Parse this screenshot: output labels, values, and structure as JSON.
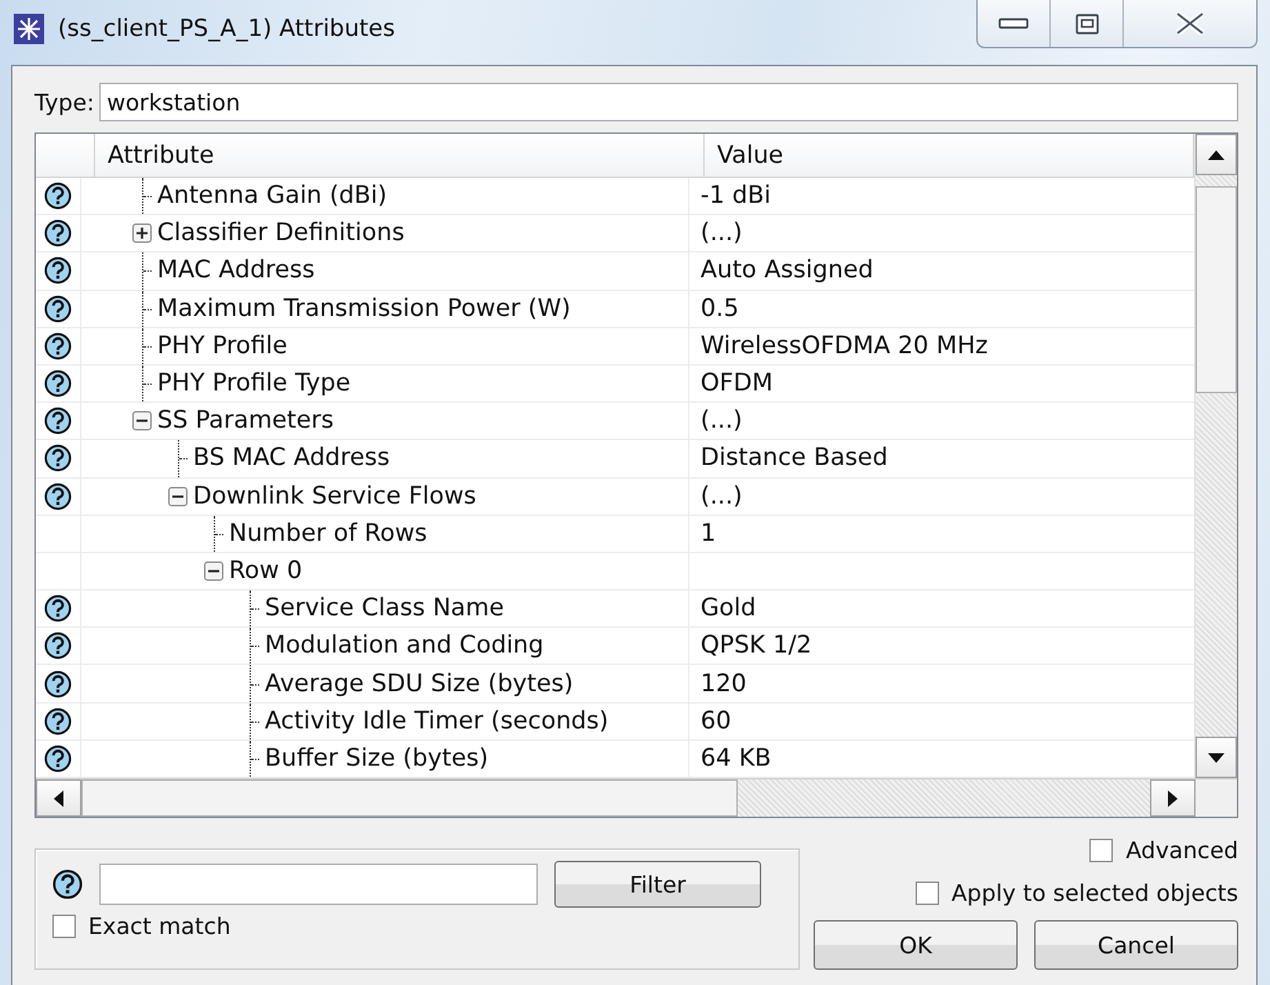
{
  "window": {
    "title": "(ss_client_PS_A_1) Attributes"
  },
  "type_field": {
    "label": "Type:",
    "value": "workstation"
  },
  "table": {
    "columns": [
      "Attribute",
      "Value"
    ],
    "rows": [
      {
        "label": "Antenna Gain (dBi)",
        "value": "-1 dBi",
        "help": true
      },
      {
        "label": "Classifier Definitions",
        "value": "(...)",
        "help": true,
        "expanded": false
      },
      {
        "label": "MAC Address",
        "value": "Auto Assigned",
        "help": true
      },
      {
        "label": "Maximum Transmission Power (W)",
        "value": "0.5",
        "help": true
      },
      {
        "label": "PHY Profile",
        "value": "WirelessOFDMA 20 MHz",
        "help": true
      },
      {
        "label": "PHY Profile Type",
        "value": "OFDM",
        "help": true
      },
      {
        "label": "SS Parameters",
        "value": "(...)",
        "help": true,
        "expanded": true,
        "children": [
          {
            "label": "BS MAC Address",
            "value": "Distance Based",
            "help": true
          },
          {
            "label": "Downlink Service Flows",
            "value": "(...)",
            "help": true,
            "expanded": true,
            "children": [
              {
                "label": "Number of Rows",
                "value": "1",
                "help": false
              },
              {
                "label": "Row 0",
                "help": false,
                "expanded": true,
                "children": [
                  {
                    "label": "Service Class Name",
                    "value": "Gold",
                    "help": true
                  },
                  {
                    "label": "Modulation and Coding",
                    "value": "QPSK 1/2",
                    "help": true
                  },
                  {
                    "label": "Average SDU Size (bytes)",
                    "value": "120",
                    "help": true
                  },
                  {
                    "label": "Activity Idle Timer (seconds)",
                    "value": "60",
                    "help": true
                  },
                  {
                    "label": "Buffer Size (bytes)",
                    "value": "64 KB",
                    "help": true
                  }
                ]
              }
            ]
          }
        ]
      }
    ]
  },
  "filter": {
    "help": true,
    "button": "Filter",
    "exact_match": {
      "label": "Exact match",
      "checked": false
    }
  },
  "advanced": {
    "label": "Advanced",
    "checked": false
  },
  "apply_selected": {
    "label": "Apply to selected objects",
    "checked": false
  },
  "buttons": [
    "OK",
    "Cancel"
  ]
}
